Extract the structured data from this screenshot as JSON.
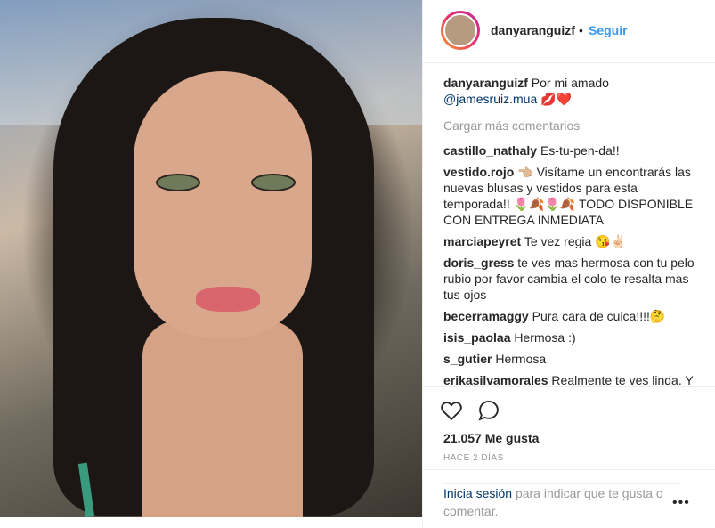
{
  "post": {
    "author": "danyaranguizf",
    "follow_separator": "•",
    "follow_label": "Seguir",
    "caption_user": "danyaranguizf",
    "caption_text": "Por mi amado",
    "caption_mention": "@jamesruiz.mua",
    "caption_emoji": "💋❤️"
  },
  "comments": {
    "load_more": "Cargar más comentarios",
    "items": [
      {
        "user": "castillo_nathaly",
        "text": "Es-tu-pen-da!!"
      },
      {
        "user": "vestido.rojo",
        "text": "👈🏼 Visítame un encontrarás las nuevas blusas y vestidos para esta temporada!! 🌷🍂🌷🍂 TODO DISPONIBLE CON ENTREGA INMEDIATA"
      },
      {
        "user": "marciapeyret",
        "text": "Te vez regia 😘✌🏻"
      },
      {
        "user": "doris_gress",
        "text": "te ves mas hermosa con tu pelo rubio por favor cambia el colo te resalta mas tus ojos"
      },
      {
        "user": "becerramaggy",
        "text": "Pura cara de cuica!!!!🤔"
      },
      {
        "user": "isis_paolaa",
        "text": "Hermosa :)"
      },
      {
        "user": "s_gutier",
        "text": "Hermosa"
      },
      {
        "user": "erikasilvamorales",
        "text": "Realmente te ves linda. Y"
      }
    ]
  },
  "stats": {
    "likes": "21.057 Me gusta",
    "time": "HACE 2 DÍAS"
  },
  "login": {
    "link": "Inicia sesión",
    "text": "para indicar que te gusta o comentar."
  },
  "icons": {
    "like": "heart-icon",
    "comment": "comment-icon",
    "more": "more-options-icon"
  },
  "colors": {
    "accent": "#3897f0",
    "link": "#003569",
    "muted": "#999999"
  }
}
